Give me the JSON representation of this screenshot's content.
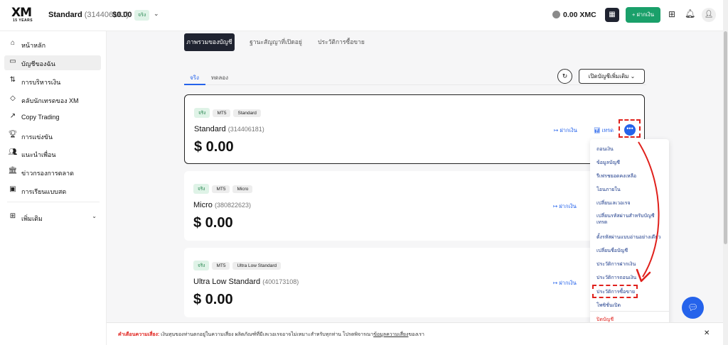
{
  "header": {
    "logo_main": "XM",
    "logo_sub": "15 YEARS",
    "account_type": "Standard",
    "account_number": "(314406181)",
    "balance": "$0.00",
    "real_badge": "จริง",
    "xmc_balance": "0.00 XMC",
    "deposit_label": "+ ฝากเงิน"
  },
  "sidebar": {
    "items": [
      {
        "label": "หน้าหลัก"
      },
      {
        "label": "บัญชีของฉัน"
      },
      {
        "label": "การบริหารเงิน"
      },
      {
        "label": "คลับนักเทรดของ XM"
      },
      {
        "label": "Copy Trading"
      },
      {
        "label": "การแข่งขัน"
      },
      {
        "label": "แนะนำเพื่อน"
      },
      {
        "label": "ข่าวกรองการตลาด"
      },
      {
        "label": "การเรียนแบบสด"
      }
    ],
    "more_label": "เพิ่มเติม"
  },
  "tabs": {
    "overview": "ภาพรวมของบัญชี",
    "open_positions": "ฐานะสัญญาที่เปิดอยู่",
    "trade_history": "ประวัติการซื้อขาย"
  },
  "subtabs": {
    "real": "จริง",
    "demo": "ทดลอง"
  },
  "open_account_label": "เปิดบัญชีเพิ่มเติม",
  "cards": [
    {
      "tags": [
        "จริง",
        "MT5",
        "Standard"
      ],
      "name": "Standard",
      "number": "(314406181)",
      "balance": "$ 0.00",
      "deposit": "ฝากเงิน",
      "trade": "เทรด"
    },
    {
      "tags": [
        "จริง",
        "MT5",
        "Micro"
      ],
      "name": "Micro",
      "number": "(380822623)",
      "balance": "$ 0.00",
      "deposit": "ฝากเงิน"
    },
    {
      "tags": [
        "จริง",
        "MT5",
        "Ultra Low Standard"
      ],
      "name": "Ultra Low Standard",
      "number": "(400173108)",
      "balance": "$ 0.00",
      "deposit": "ฝากเงิน"
    }
  ],
  "menu": {
    "items": [
      "ถอนเงิน",
      "ข้อมูลบัญชี",
      "รีเฟรชยอดคงเหลือ",
      "โอนภายใน",
      "เปลี่ยนเลเวอเรจ",
      "เปลี่ยนรหัสผ่านสำหรับบัญชีเทรด",
      "ตั้งรหัสผ่านแบบอ่านอย่างเดียว",
      "เปลี่ยนชื่อบัญชี",
      "ประวัติการฝากเงิน",
      "ประวัติการถอนเงิน",
      "ประวัติการซื้อขาย",
      "โพซิชั่นเปิด"
    ],
    "close_label": "ปิดบัญชี"
  },
  "risk": {
    "warning_label": "คำเตือนความเสี่ยง:",
    "body": " เงินทุนของท่านตกอยู่ในความเสี่ยง ผลิตภัณฑ์ที่มีเลเวอเรจอาจไม่เหมาะสำหรับทุกท่าน โปรดพิจารณา",
    "link": "ข้อมูลความเสี่ยง",
    "suffix": "ของเรา"
  },
  "colors": {
    "accent_blue": "#2563eb",
    "brand_green": "#1aa06a",
    "annotation_red": "#e0211c",
    "dark": "#1f2330"
  }
}
